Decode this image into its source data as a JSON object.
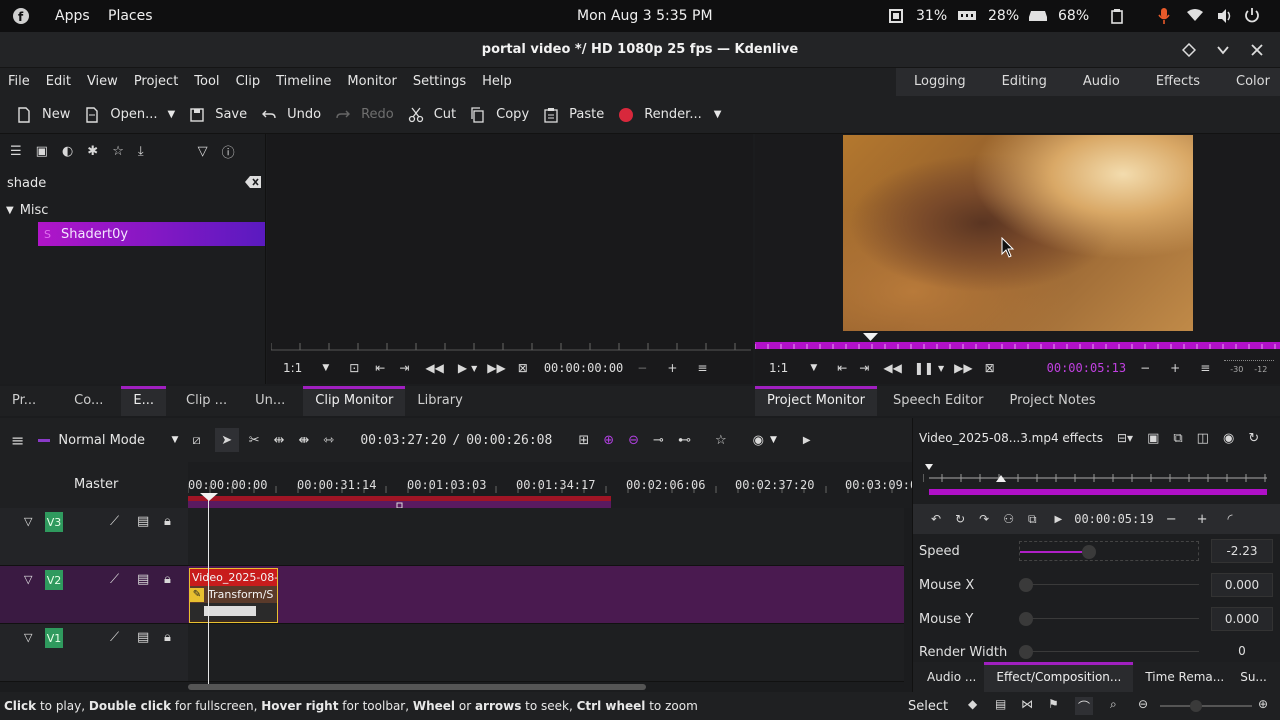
{
  "system_bar": {
    "apps": "Apps",
    "places": "Places",
    "datetime": "Mon Aug 3    5:35 PM",
    "cpu": "31%",
    "memory": "28%",
    "storage": "68%"
  },
  "window": {
    "title": "portal video */ HD 1080p 25 fps — Kdenlive"
  },
  "menu": [
    "File",
    "Edit",
    "View",
    "Project",
    "Tool",
    "Clip",
    "Timeline",
    "Monitor",
    "Settings",
    "Help"
  ],
  "workspaces": [
    "Logging",
    "Editing",
    "Audio",
    "Effects",
    "Color"
  ],
  "toolbar": {
    "new": "New",
    "open": "Open...",
    "save": "Save",
    "undo": "Undo",
    "redo": "Redo",
    "cut": "Cut",
    "copy": "Copy",
    "paste": "Paste",
    "render": "Render..."
  },
  "effects_panel": {
    "search_value": "shade",
    "category": "Misc",
    "item_letter": "S",
    "item": "Shadert0y"
  },
  "clip_monitor": {
    "zoom": "1:1",
    "timecode": "00:00:00:00"
  },
  "project_monitor": {
    "zoom": "1:1",
    "timecode": "00:00:05:13",
    "meter_left": "-30",
    "meter_right": "-12"
  },
  "left_tabs": [
    "Pr...",
    "Co...",
    "E...",
    "Clip ...",
    "Un...",
    "Clip Monitor",
    "Library"
  ],
  "right_tabs": [
    "Project Monitor",
    "Speech Editor",
    "Project Notes"
  ],
  "timeline": {
    "mode": "Normal Mode",
    "position": "00:03:27:20",
    "separator": "/",
    "duration": "00:00:26:08",
    "master": "Master",
    "ruler": [
      "00:00:00:00",
      "00:00:31:14",
      "00:01:03:03",
      "00:01:34:17",
      "00:02:06:06",
      "00:02:37:20",
      "00:03:09:09"
    ],
    "tracks": [
      "V3",
      "V2",
      "V1"
    ],
    "clip_name": "Video_2025-08-",
    "clip_effect": "Transform/S"
  },
  "effect_stack": {
    "title": "Video_2025-08...3.mp4 effects",
    "timecode": "00:00:05:19",
    "params": [
      {
        "name": "Speed",
        "value": "-2.23",
        "level": 0.39
      },
      {
        "name": "Mouse X",
        "value": "0.000",
        "level": 0.0
      },
      {
        "name": "Mouse Y",
        "value": "0.000",
        "level": 0.0
      },
      {
        "name": "Render Width",
        "value": "0",
        "level": 0.0
      }
    ]
  },
  "bottom_tabs": [
    "Audio ...",
    "Effect/Composition...",
    "Time Rema...",
    "Su..."
  ],
  "status": {
    "b1": "Click",
    "t1": " to play, ",
    "b2": "Double click",
    "t2": " for fullscreen, ",
    "b3": "Hover right",
    "t3": " for toolbar, ",
    "b4": "Wheel",
    "t4": " or ",
    "b5": "arrows",
    "t5": " to seek, ",
    "b6": "Ctrl wheel",
    "t6": " to zoom",
    "select": "Select"
  },
  "colors": {
    "accent": "#a020c0",
    "track_bg": "#4a1a50",
    "clip_red": "#c81c1c"
  }
}
